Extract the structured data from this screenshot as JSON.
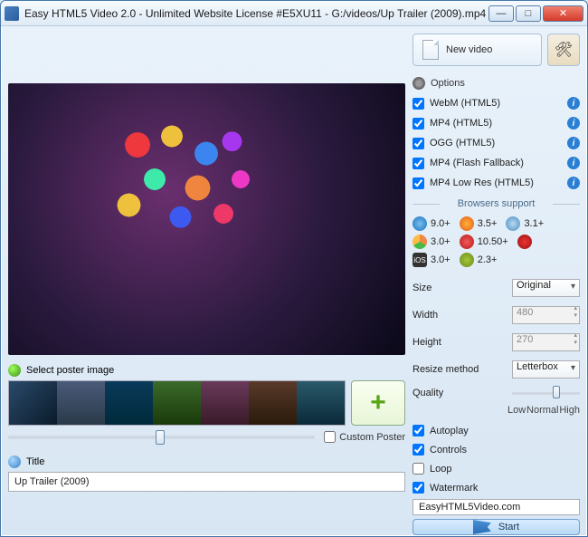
{
  "window": {
    "title": "Easy HTML5 Video 2.0  - Unlimited Website License #E5XU11 - G:/videos/Up Trailer (2009).mp4"
  },
  "topbar": {
    "new_video": "New video"
  },
  "options": {
    "label": "Options",
    "formats": [
      {
        "label": "WebM (HTML5)",
        "checked": true
      },
      {
        "label": "MP4 (HTML5)",
        "checked": true
      },
      {
        "label": "OGG (HTML5)",
        "checked": true
      },
      {
        "label": "MP4 (Flash Fallback)",
        "checked": true
      },
      {
        "label": "MP4 Low Res (HTML5)",
        "checked": true
      }
    ]
  },
  "browsers": {
    "label": "Browsers support",
    "items": [
      {
        "name": "ie",
        "ver": "9.0+"
      },
      {
        "name": "ff",
        "ver": "3.5+"
      },
      {
        "name": "sf",
        "ver": "3.1+"
      },
      {
        "name": "ch",
        "ver": "3.0+"
      },
      {
        "name": "op",
        "ver": "10.50+"
      },
      {
        "name": "os",
        "ver": ""
      },
      {
        "name": "ios",
        "ver": "3.0+"
      },
      {
        "name": "and",
        "ver": "2.3+"
      }
    ]
  },
  "size": {
    "label": "Size",
    "value": "Original",
    "width_label": "Width",
    "width_value": "480",
    "height_label": "Height",
    "height_value": "270",
    "resize_label": "Resize method",
    "resize_value": "Letterbox",
    "quality_label": "Quality",
    "q_low": "Low",
    "q_normal": "Normal",
    "q_high": "High"
  },
  "playback": {
    "autoplay": {
      "label": "Autoplay",
      "checked": true
    },
    "controls": {
      "label": "Controls",
      "checked": true
    },
    "loop": {
      "label": "Loop",
      "checked": false
    },
    "watermark": {
      "label": "Watermark",
      "checked": true
    },
    "watermark_text": "EasyHTML5Video.com"
  },
  "poster": {
    "label": "Select poster image",
    "custom_label": "Custom Poster",
    "custom_checked": false
  },
  "title": {
    "label": "Title",
    "value": "Up Trailer (2009)"
  },
  "start": "Start"
}
